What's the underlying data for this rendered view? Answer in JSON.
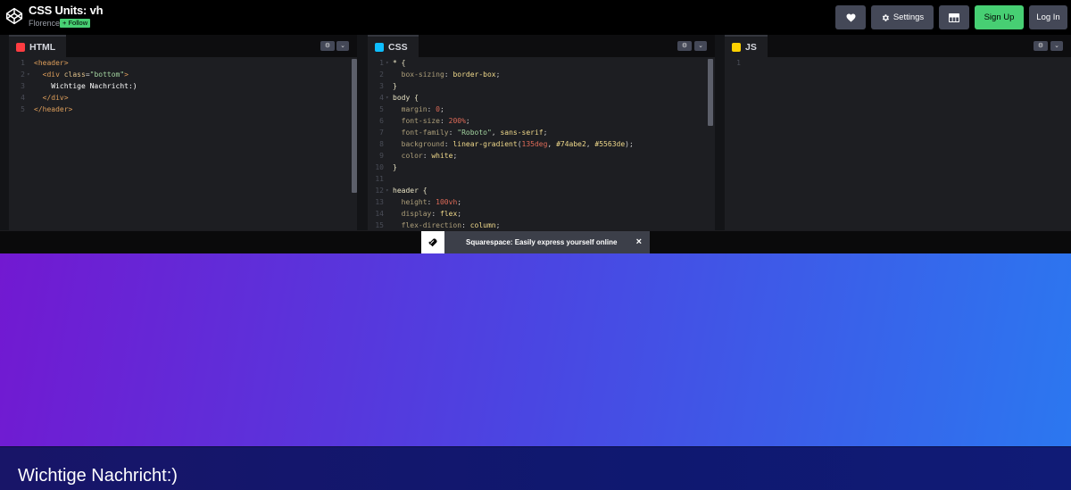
{
  "header": {
    "title": "CSS Units: vh",
    "author": "Florence",
    "follow_label": "+ Follow",
    "settings_label": "Settings",
    "signup_label": "Sign Up",
    "login_label": "Log In"
  },
  "panels": {
    "html": {
      "tab_label": "HTML",
      "lines": [
        {
          "n": "1",
          "fold": "",
          "parts": [
            {
              "c": "c-tag",
              "t": "<header>"
            }
          ]
        },
        {
          "n": "2",
          "fold": "▾",
          "parts": [
            {
              "c": "c-tag",
              "t": "  <div "
            },
            {
              "c": "c-attr",
              "t": "class"
            },
            {
              "c": "c-punc",
              "t": "="
            },
            {
              "c": "c-str",
              "t": "\"bottom\""
            },
            {
              "c": "c-tag",
              "t": ">"
            }
          ]
        },
        {
          "n": "3",
          "fold": "",
          "parts": [
            {
              "c": "c-text",
              "t": "    Wichtige Nachricht:)"
            }
          ]
        },
        {
          "n": "4",
          "fold": "",
          "parts": [
            {
              "c": "c-tag",
              "t": "  </div>"
            }
          ]
        },
        {
          "n": "5",
          "fold": "",
          "parts": [
            {
              "c": "c-tag",
              "t": "</header>"
            }
          ]
        }
      ]
    },
    "css": {
      "tab_label": "CSS",
      "lines": [
        {
          "n": "1",
          "fold": "▾",
          "parts": [
            {
              "c": "c-sel",
              "t": "* {"
            }
          ]
        },
        {
          "n": "2",
          "fold": "",
          "parts": [
            {
              "c": "c-prop",
              "t": "  box-sizing"
            },
            {
              "c": "c-punc",
              "t": ": "
            },
            {
              "c": "c-val",
              "t": "border-box"
            },
            {
              "c": "c-punc",
              "t": ";"
            }
          ]
        },
        {
          "n": "3",
          "fold": "",
          "parts": [
            {
              "c": "c-sel",
              "t": "}"
            }
          ]
        },
        {
          "n": "4",
          "fold": "▾",
          "parts": [
            {
              "c": "c-sel",
              "t": "body {"
            }
          ]
        },
        {
          "n": "5",
          "fold": "",
          "parts": [
            {
              "c": "c-prop",
              "t": "  margin"
            },
            {
              "c": "c-punc",
              "t": ": "
            },
            {
              "c": "c-num",
              "t": "0"
            },
            {
              "c": "c-punc",
              "t": ";"
            }
          ]
        },
        {
          "n": "6",
          "fold": "",
          "parts": [
            {
              "c": "c-prop",
              "t": "  font-size"
            },
            {
              "c": "c-punc",
              "t": ": "
            },
            {
              "c": "c-num",
              "t": "200%"
            },
            {
              "c": "c-punc",
              "t": ";"
            }
          ]
        },
        {
          "n": "7",
          "fold": "",
          "parts": [
            {
              "c": "c-prop",
              "t": "  font-family"
            },
            {
              "c": "c-punc",
              "t": ": "
            },
            {
              "c": "c-str",
              "t": "\"Roboto\""
            },
            {
              "c": "c-punc",
              "t": ", "
            },
            {
              "c": "c-val",
              "t": "sans-serif"
            },
            {
              "c": "c-punc",
              "t": ";"
            }
          ]
        },
        {
          "n": "8",
          "fold": "",
          "parts": [
            {
              "c": "c-prop",
              "t": "  background"
            },
            {
              "c": "c-punc",
              "t": ": "
            },
            {
              "c": "c-val",
              "t": "linear-gradient"
            },
            {
              "c": "c-punc",
              "t": "("
            },
            {
              "c": "c-num",
              "t": "135deg"
            },
            {
              "c": "c-punc",
              "t": ", "
            },
            {
              "c": "c-val",
              "t": "#74abe2"
            },
            {
              "c": "c-punc",
              "t": ", "
            },
            {
              "c": "c-val",
              "t": "#5563de"
            },
            {
              "c": "c-punc",
              "t": ");"
            }
          ]
        },
        {
          "n": "9",
          "fold": "",
          "parts": [
            {
              "c": "c-prop",
              "t": "  color"
            },
            {
              "c": "c-punc",
              "t": ": "
            },
            {
              "c": "c-val",
              "t": "white"
            },
            {
              "c": "c-punc",
              "t": ";"
            }
          ]
        },
        {
          "n": "10",
          "fold": "",
          "parts": [
            {
              "c": "c-sel",
              "t": "}"
            }
          ]
        },
        {
          "n": "11",
          "fold": "",
          "parts": [
            {
              "c": "c-sel",
              "t": ""
            }
          ]
        },
        {
          "n": "12",
          "fold": "▾",
          "parts": [
            {
              "c": "c-sel",
              "t": "header {"
            }
          ]
        },
        {
          "n": "13",
          "fold": "",
          "parts": [
            {
              "c": "c-prop",
              "t": "  height"
            },
            {
              "c": "c-punc",
              "t": ": "
            },
            {
              "c": "c-num",
              "t": "100vh"
            },
            {
              "c": "c-punc",
              "t": ";"
            }
          ]
        },
        {
          "n": "14",
          "fold": "",
          "parts": [
            {
              "c": "c-prop",
              "t": "  display"
            },
            {
              "c": "c-punc",
              "t": ": "
            },
            {
              "c": "c-val",
              "t": "flex"
            },
            {
              "c": "c-punc",
              "t": ";"
            }
          ]
        },
        {
          "n": "15",
          "fold": "",
          "parts": [
            {
              "c": "c-prop",
              "t": "  flex-direction"
            },
            {
              "c": "c-punc",
              "t": ": "
            },
            {
              "c": "c-val",
              "t": "column"
            },
            {
              "c": "c-punc",
              "t": ";"
            }
          ]
        }
      ]
    },
    "js": {
      "tab_label": "JS",
      "lines": [
        {
          "n": "1",
          "fold": "",
          "parts": []
        }
      ]
    }
  },
  "ad": {
    "text": "Squarespace: Easily express yourself online",
    "close": "×"
  },
  "preview": {
    "message": "Wichtige Nachricht:)"
  },
  "colors": {
    "signup_green": "#47cf73",
    "button_gray": "#444857",
    "editor_bg": "#1d1e22"
  },
  "icons": [
    "codepen-logo-icon",
    "heart-icon",
    "gear-icon",
    "layout-icon",
    "html-icon",
    "css-icon",
    "js-icon",
    "chevron-down-icon",
    "squarespace-logo-icon",
    "close-icon"
  ]
}
